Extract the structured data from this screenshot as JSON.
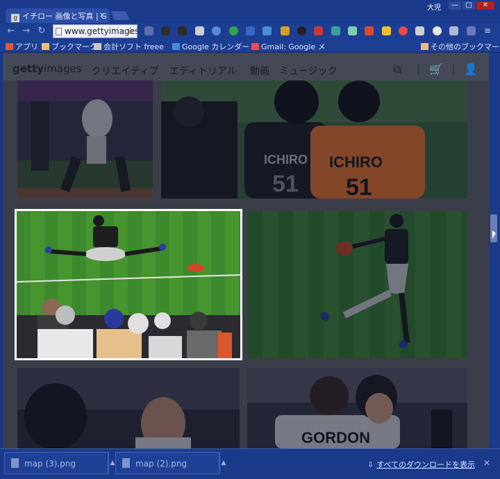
{
  "browser": {
    "tab_title": "イチロー 画像と写真 | G",
    "tab_favicon": "g",
    "tab_close": "×",
    "user_badge": "大児",
    "win_minimize": "—",
    "win_maximize": "□",
    "win_close": "✕",
    "url": "www.gettyimages",
    "back": "←",
    "forward": "→",
    "reload": "↻",
    "star": "☆",
    "bookmarks": [
      {
        "label": "アプリ",
        "icon": "apps-icon"
      },
      {
        "label": "ブックマーク",
        "icon": "folder-icon"
      },
      {
        "label": "会計ソフト freee",
        "icon": "doc-icon"
      },
      {
        "label": "Google カレンダー",
        "icon": "calendar-icon"
      },
      {
        "label": "Gmail: Google メ",
        "icon": "gmail-icon"
      },
      {
        "label": "その他のブックマーク",
        "icon": "folder-icon"
      }
    ]
  },
  "site": {
    "logo_bold": "getty",
    "logo_light": "images",
    "nav": [
      "クリエイティブ",
      "エディトリアル",
      "動画",
      "ミュージック"
    ],
    "board_icon": "⧉",
    "cart_icon": "🛒",
    "user_icon": "👤"
  },
  "photos": [
    {
      "name": "photo-batter",
      "desc": "batter"
    },
    {
      "name": "photo-fans-jerseys",
      "desc": "fans"
    },
    {
      "name": "photo-stretching",
      "desc": "stretch"
    },
    {
      "name": "photo-throwing",
      "desc": "throw"
    },
    {
      "name": "photo-helmet",
      "desc": "helmet"
    },
    {
      "name": "photo-gordon",
      "desc": "gordon"
    }
  ],
  "downloads": {
    "items": [
      "map (3).png",
      "map (2).png"
    ],
    "caret": "▲",
    "show_all": "すべてのダウンロードを表示",
    "close": "✕",
    "download_icon": "⇩"
  },
  "colors": {
    "accent": "#1a3b8c",
    "highlight_border": "#ffffff"
  }
}
